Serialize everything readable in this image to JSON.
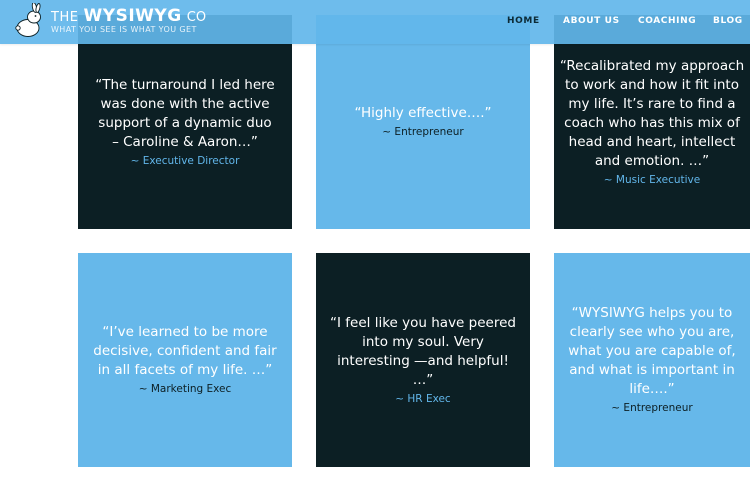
{
  "header": {
    "brand_the": "THE",
    "brand_name": "WYSIWYG",
    "brand_co": "CO",
    "tagline": "WHAT YOU SEE IS WHAT YOU GET",
    "nav": [
      "HOME",
      "ABOUT US",
      "COACHING",
      "BLOG"
    ],
    "active_nav": "HOME"
  },
  "colors": {
    "header_blue": "#62b6ea",
    "tile_dark": "#0c1f24",
    "tile_light": "#66b8ea"
  },
  "testimonials": [
    {
      "quote": "“The turnaround I led here was done with the active support of a dynamic duo – Caroline & Aaron…”",
      "author": "~ Executive Director",
      "theme": "dark"
    },
    {
      "quote": "“Highly effective….”",
      "author": "~ Entrepreneur",
      "theme": "light"
    },
    {
      "quote": "“Recalibrated my approach to work and how it fit into my life. It’s rare to find a coach who has this mix of head and heart, intellect and emotion. …”",
      "author": "~ Music Executive",
      "theme": "dark"
    },
    {
      "quote": "“I’ve learned to be more decisive, confident and fair in all facets of my life. …”",
      "author": "~ Marketing Exec",
      "theme": "light"
    },
    {
      "quote": "“I feel like you have peered into my soul. Very interesting —and helpful! …”",
      "author": "~ HR Exec",
      "theme": "dark"
    },
    {
      "quote": "“WYSIWYG helps you to clearly see who you are, what you are capable of, and what is important in life….”",
      "author": "~ Entrepreneur",
      "theme": "light"
    }
  ]
}
